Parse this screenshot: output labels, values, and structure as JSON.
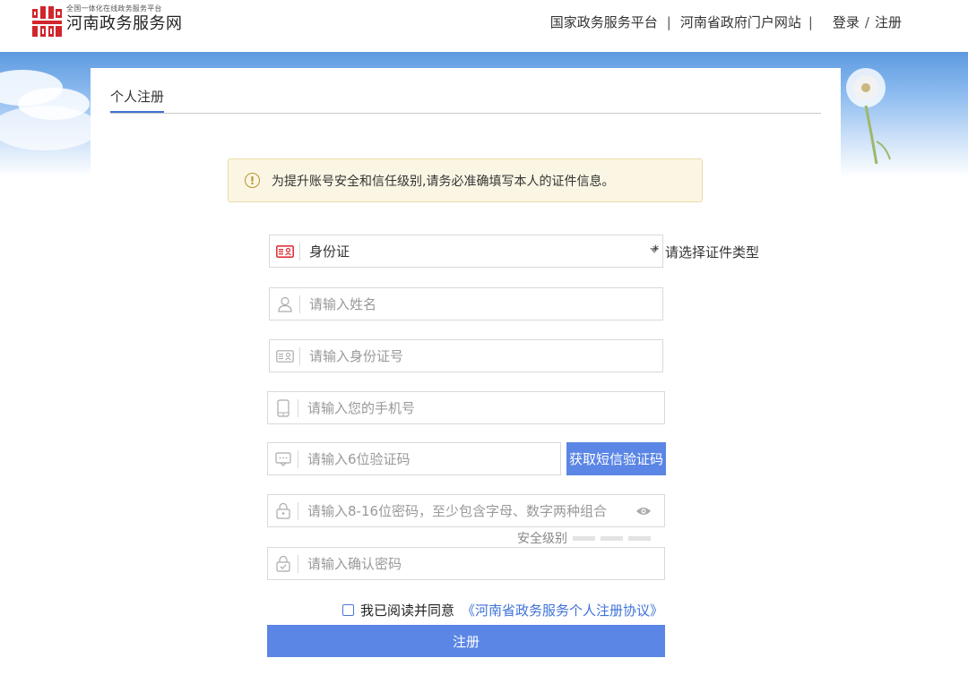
{
  "header": {
    "logo_subtitle": "全国一体化在线政务服务平台",
    "logo_title": "河南政务服务网",
    "nav": {
      "national_platform": "国家政务服务平台",
      "separator": "|",
      "provincial_portal": "河南省政府门户网站",
      "login": "登录",
      "slash": "/",
      "register": "注册"
    }
  },
  "tab": {
    "label": "个人注册"
  },
  "notice": {
    "icon": "info-icon",
    "text": "为提升账号安全和信任级别,请务必准确填写本人的证件信息。"
  },
  "form": {
    "id_type": {
      "icon": "id-card-icon",
      "value": "身份证",
      "required_mark": "*",
      "hint": "请选择证件类型"
    },
    "name": {
      "icon": "person-icon",
      "placeholder": "请输入姓名"
    },
    "id_number": {
      "icon": "id-card-icon",
      "placeholder": "请输入身份证号"
    },
    "phone": {
      "icon": "mobile-icon",
      "placeholder": "请输入您的手机号"
    },
    "sms_code": {
      "icon": "message-icon",
      "placeholder": "请输入6位验证码",
      "button": "获取短信验证码"
    },
    "password": {
      "icon": "lock-icon",
      "placeholder": "请输入8-16位密码，至少包含字母、数字两种组合",
      "toggle_icon": "eye-icon"
    },
    "strength": {
      "label": "安全级别",
      "levels": 3,
      "level_active": 0
    },
    "confirm_password": {
      "icon": "lock-icon",
      "placeholder": "请输入确认密码"
    },
    "agreement": {
      "text": "我已阅读并同意",
      "link": "《河南省政务服务个人注册协议》",
      "checked": false
    },
    "submit": "注册"
  },
  "colors": {
    "primary": "#5b86e5",
    "tab_underline": "#3f73cf",
    "notice_bg": "#fbf6e4",
    "logo_red": "#d0262c",
    "link": "#3e72d8"
  }
}
